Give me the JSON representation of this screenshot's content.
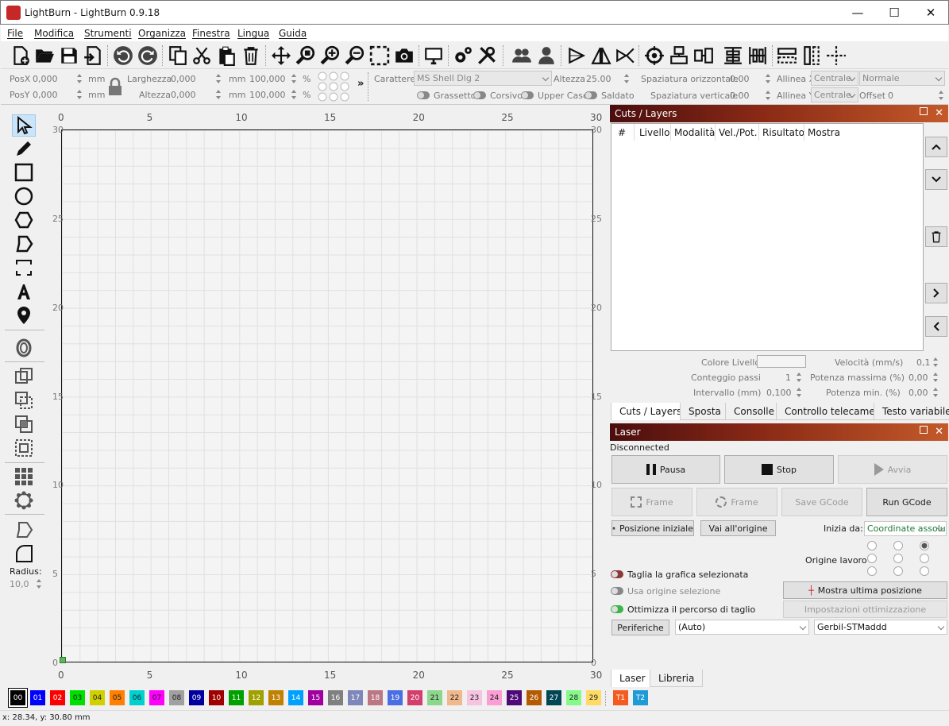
{
  "window": {
    "title": "LightBurn - LightBurn 0.9.18"
  },
  "menu": [
    "File",
    "Modifica",
    "Strumenti",
    "Organizza",
    "Finestra",
    "Lingua",
    "Guida"
  ],
  "props": {
    "posx_label": "PosX",
    "posx": "0,000",
    "posy_label": "PosY",
    "posy": "0,000",
    "unit": "mm",
    "width_label": "Larghezza",
    "width": "0,000",
    "height_label": "Altezza",
    "height": "0,000",
    "scalex": "100,000",
    "scaley": "100,000",
    "percent": "%",
    "font_label": "Carattere",
    "font": "MS Shell Dlg 2",
    "fheight_label": "Altezza",
    "fheight": "25.00",
    "hspace_label": "Spaziatura orizzontale",
    "hspace": "0.00",
    "vspace_label": "Spaziatura verticale",
    "vspace": "0.00",
    "alignx_label": "Allinea X",
    "alignx": "Centrale",
    "aligny_label": "Allinea Y",
    "aligny": "Centrale",
    "style": "Normale",
    "offset_label": "Offset",
    "offset": "0",
    "bold": "Grassetto",
    "italic": "Corsivo",
    "upper": "Upper Case",
    "welded": "Saldato"
  },
  "radius": {
    "label": "Radius:",
    "value": "10,0"
  },
  "ruler": {
    "top": [
      "0",
      "5",
      "10",
      "15",
      "20",
      "25",
      "30"
    ],
    "side": [
      "30",
      "25",
      "20",
      "15",
      "10",
      "5",
      "0"
    ]
  },
  "cuts": {
    "title": "Cuts / Layers",
    "columns": [
      "#",
      "Livello",
      "Modalità",
      "Vel./Pot.",
      "Risultato",
      "Mostra"
    ],
    "color_label": "Colore Livello",
    "speed_label": "Velocità (mm/s)",
    "speed": "0,1",
    "passes_label": "Conteggio passi",
    "passes": "1",
    "maxpow_label": "Potenza massima (%)",
    "maxpow": "0,00",
    "interval_label": "Intervallo (mm)",
    "interval": "0,100",
    "minpow_label": "Potenza min. (%)",
    "minpow": "0,00",
    "tabs": [
      "Cuts / Layers",
      "Sposta",
      "Consolle",
      "Controllo telecamera",
      "Testo variabile"
    ]
  },
  "laser": {
    "title": "Laser",
    "status": "Disconnected",
    "pause": "Pausa",
    "stop": "Stop",
    "start": "Avvia",
    "frame1": "Frame",
    "frame2": "Frame",
    "savegcode": "Save GCode",
    "rungcode": "Run GCode",
    "home": "Posizione iniziale",
    "goorigin": "Vai all'origine",
    "start_from_label": "Inizia da:",
    "start_from": "Coordinate assolute",
    "job_origin_label": "Origine lavoro",
    "cut_selected": "Taglia la grafica selezionata",
    "use_sel_origin": "Usa origine selezione",
    "optimize": "Ottimizza il percorso di taglio",
    "show_last": "Mostra ultima posizione",
    "opt_settings": "Impostazioni ottimizzazione",
    "devices": "Periferiche",
    "port": "(Auto)",
    "device": "Gerbil-STMaddd",
    "tabs": [
      "Laser",
      "Libreria"
    ]
  },
  "palette": [
    {
      "l": "00",
      "c": "#000000"
    },
    {
      "l": "01",
      "c": "#0000ff"
    },
    {
      "l": "02",
      "c": "#ff0000"
    },
    {
      "l": "03",
      "c": "#00e000"
    },
    {
      "l": "04",
      "c": "#d0d000"
    },
    {
      "l": "05",
      "c": "#ff8000"
    },
    {
      "l": "06",
      "c": "#00d0d0"
    },
    {
      "l": "07",
      "c": "#ff00ff"
    },
    {
      "l": "08",
      "c": "#a0a0a0"
    },
    {
      "l": "09",
      "c": "#0000a0"
    },
    {
      "l": "10",
      "c": "#a00000"
    },
    {
      "l": "11",
      "c": "#00a000"
    },
    {
      "l": "12",
      "c": "#a0a000"
    },
    {
      "l": "13",
      "c": "#c08000"
    },
    {
      "l": "14",
      "c": "#00a0ff"
    },
    {
      "l": "15",
      "c": "#a000a0"
    },
    {
      "l": "16",
      "c": "#808080"
    },
    {
      "l": "17",
      "c": "#7d87b9"
    },
    {
      "l": "18",
      "c": "#bb7784"
    },
    {
      "l": "19",
      "c": "#4a6fe3"
    },
    {
      "l": "20",
      "c": "#d33f6a"
    },
    {
      "l": "21",
      "c": "#8cd78c"
    },
    {
      "l": "22",
      "c": "#f0b98d"
    },
    {
      "l": "23",
      "c": "#f6c4e1"
    },
    {
      "l": "24",
      "c": "#fa9ed4"
    },
    {
      "l": "25",
      "c": "#500a78"
    },
    {
      "l": "26",
      "c": "#b45a00"
    },
    {
      "l": "27",
      "c": "#004754"
    },
    {
      "l": "28",
      "c": "#86fa88"
    },
    {
      "l": "29",
      "c": "#ffdb66"
    },
    {
      "l": "T1",
      "c": "#f35b20"
    },
    {
      "l": "T2",
      "c": "#1e9bd7"
    }
  ],
  "status": {
    "coords": "x: 28.34, y: 30.80 mm"
  }
}
